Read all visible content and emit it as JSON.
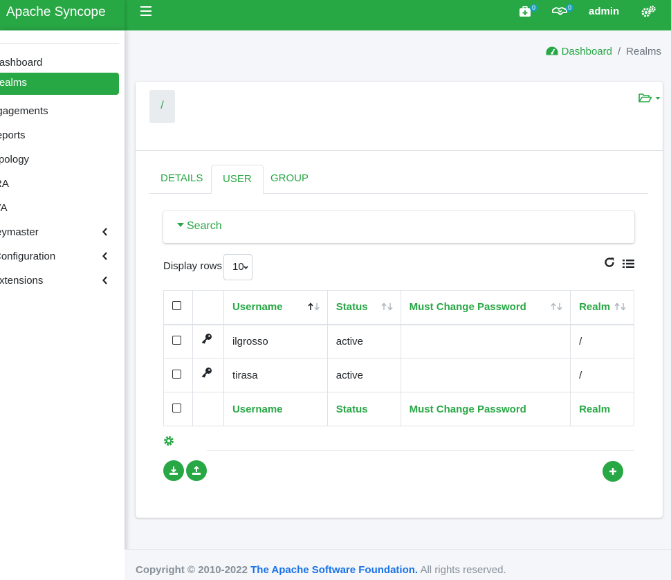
{
  "app": {
    "title": "Apache Syncope"
  },
  "navbar": {
    "notifications_count": "0",
    "tasks_count": "0",
    "user": "admin"
  },
  "sidebar": {
    "items": [
      {
        "label": "Dashboard",
        "icon": "dashboard-icon"
      },
      {
        "label": "Realms",
        "icon": "folder-icon",
        "active": true
      },
      {
        "label": "Engagements",
        "icon": "clock-icon"
      },
      {
        "label": "Reports",
        "icon": "chart-icon"
      },
      {
        "label": "Topology",
        "icon": "topology-icon"
      },
      {
        "label": "SRA",
        "icon": "sra-icon"
      },
      {
        "label": "WA",
        "icon": "wa-icon"
      },
      {
        "label": "Keymaster",
        "icon": "key-icon",
        "expandable": true
      },
      {
        "label": "Configuration",
        "icon": "wrench-icon",
        "expandable": true
      },
      {
        "label": "Extensions",
        "icon": "puzzle-icon",
        "expandable": true
      }
    ]
  },
  "breadcrumb": {
    "home": "Dashboard",
    "separator": "/",
    "current": "Realms"
  },
  "realm": {
    "path": "/"
  },
  "tabs": [
    {
      "label": "DETAILS"
    },
    {
      "label": "USER",
      "active": true
    },
    {
      "label": "GROUP"
    }
  ],
  "search": {
    "label": "Search"
  },
  "display_rows": {
    "label": "Display rows",
    "value": "10"
  },
  "table": {
    "columns": [
      "Username",
      "Status",
      "Must Change Password",
      "Realm"
    ],
    "rows": [
      {
        "username": "ilgrosso",
        "status": "active",
        "must_change_password": "",
        "realm": "/"
      },
      {
        "username": "tirasa",
        "status": "active",
        "must_change_password": "",
        "realm": "/"
      }
    ]
  },
  "footer": {
    "copyright": "Copyright © 2010-2022",
    "org": "The Apache Software Foundation.",
    "rights": "All rights reserved."
  },
  "colors": {
    "accent": "#28a745",
    "link": "#1a73e8",
    "badge": "#17a2b8"
  }
}
